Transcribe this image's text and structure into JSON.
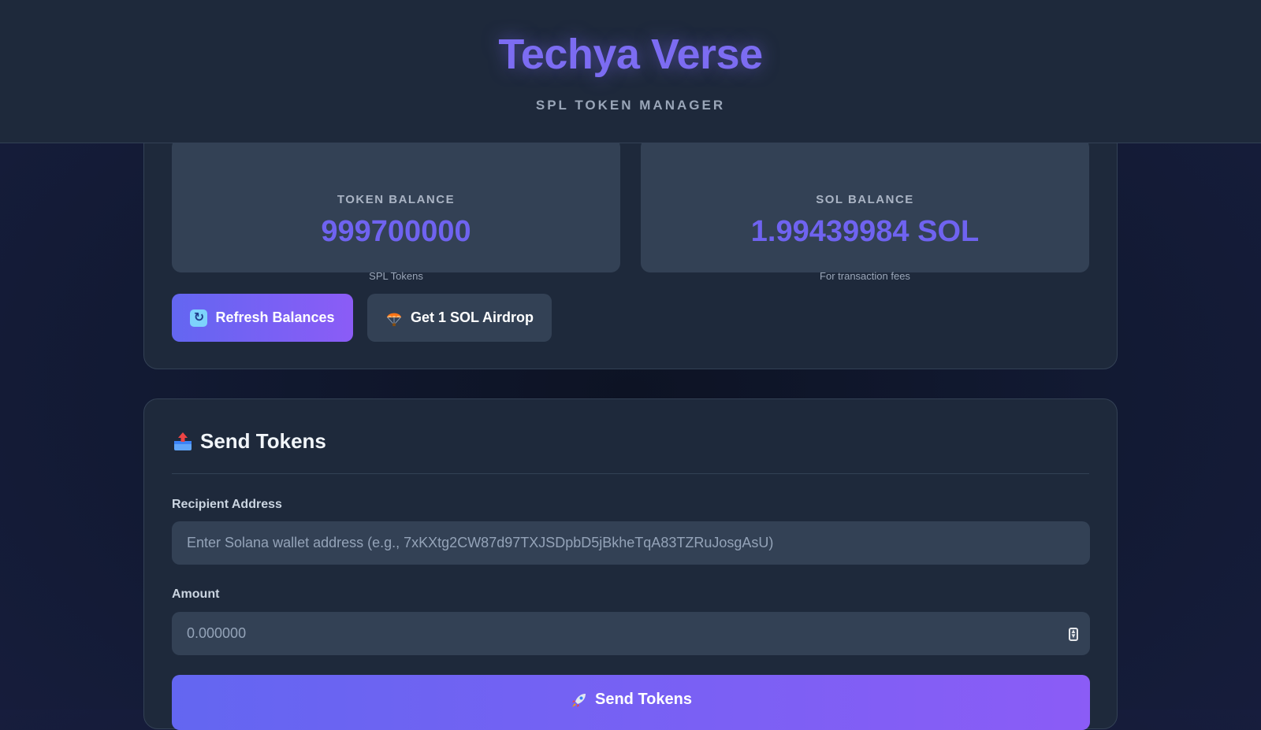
{
  "header": {
    "brand": "Techya Verse",
    "subtitle": "SPL TOKEN MANAGER"
  },
  "balances": {
    "token": {
      "label": "TOKEN BALANCE",
      "value": "999700000",
      "caption": "SPL Tokens"
    },
    "sol": {
      "label": "SOL BALANCE",
      "value": "1.99439984 SOL",
      "caption": "For transaction fees"
    },
    "actions": {
      "refresh_label": "Refresh Balances",
      "refresh_icon": "refresh-icon",
      "airdrop_label": "Get 1 SOL Airdrop",
      "airdrop_icon": "parachute-icon"
    }
  },
  "send": {
    "title": "Send Tokens",
    "title_icon": "outbox-tray-icon",
    "recipient": {
      "label": "Recipient Address",
      "value": "",
      "placeholder": "Enter Solana wallet address (e.g., 7xKXtg2CW87d97TXJSDpbD5jBkheTqA83TZRuJosgAsU)"
    },
    "amount": {
      "label": "Amount",
      "value": "",
      "placeholder": "0.000000"
    },
    "submit_label": "Send Tokens",
    "submit_icon": "rocket-icon"
  },
  "colors": {
    "accent": "#6f63f0",
    "accent_gradient_start": "#6366f1",
    "accent_gradient_end": "#8b5cf6",
    "panel": "#1e293b",
    "field": "#334155"
  }
}
